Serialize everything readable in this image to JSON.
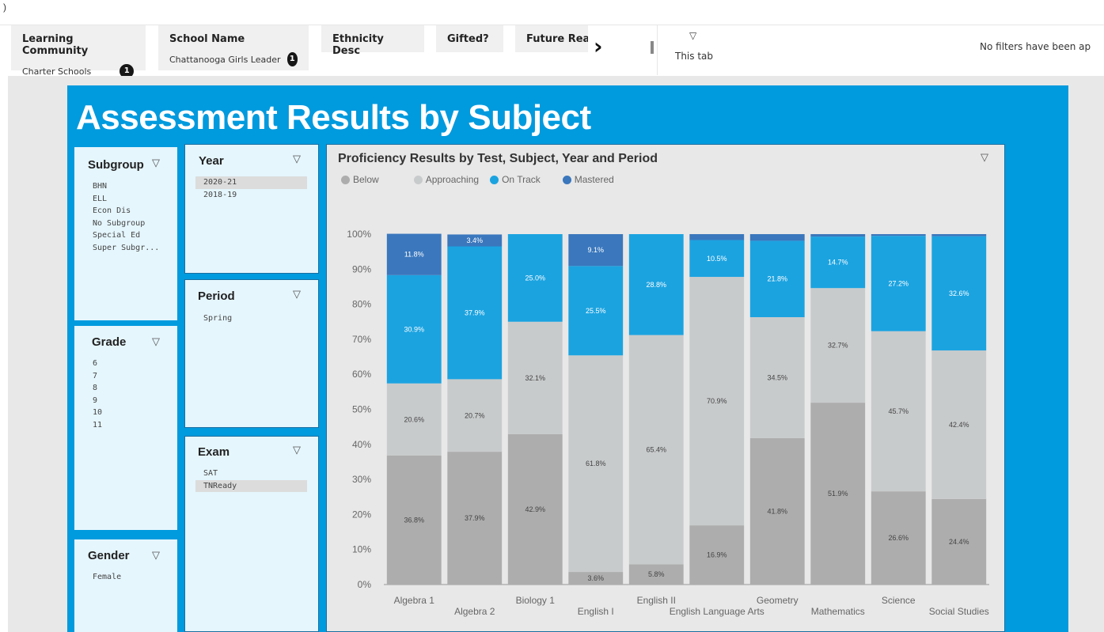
{
  "top_glyph": ")",
  "filters": [
    {
      "name": "Learning Community",
      "value": "Charter Schools",
      "badge": "1"
    },
    {
      "name": "School Name",
      "value": "Chattanooga Girls Leader",
      "badge": "1"
    },
    {
      "name": "Ethnicity Desc"
    },
    {
      "name": "Gifted?"
    },
    {
      "name": "Future Read"
    }
  ],
  "filter_tab": {
    "label": "This tab",
    "message": "No filters have been ap"
  },
  "page_title": "Assessment Results by Subject",
  "slicers": {
    "subgroup": {
      "title": "Subgroup",
      "items": [
        "BHN",
        "ELL",
        "Econ Dis",
        "No Subgroup",
        "Special Ed",
        "Super Subgr..."
      ]
    },
    "grade": {
      "title": "Grade",
      "items": [
        "6",
        "7",
        "8",
        "9",
        "10",
        "11"
      ]
    },
    "gender": {
      "title": "Gender",
      "items": [
        "Female"
      ]
    },
    "year": {
      "title": "Year",
      "items": [
        "2020-21",
        "2018-19"
      ],
      "selected": "2020-21"
    },
    "period": {
      "title": "Period",
      "items": [
        "Spring"
      ]
    },
    "exam": {
      "title": "Exam",
      "items": [
        "SAT",
        "TNReady"
      ],
      "selected": "TNReady"
    }
  },
  "colors": {
    "below": "#adadad",
    "approaching": "#c8cbcc",
    "on_track": "#1ba3e0",
    "mastered": "#3a77bd",
    "board": "#009ade"
  },
  "chart_data": {
    "type": "bar",
    "stacked": true,
    "title": "Proficiency Results by Test, Subject, Year and Period",
    "legend_position": "top-left",
    "categories": [
      "Algebra 1",
      "Algebra 2",
      "Biology 1",
      "English I",
      "English II",
      "English Language Arts",
      "Geometry",
      "Mathematics",
      "Science",
      "Social Studies"
    ],
    "series": [
      {
        "name": "Below",
        "values": [
          36.8,
          37.9,
          42.9,
          3.6,
          5.8,
          16.9,
          41.8,
          51.9,
          26.6,
          24.4
        ],
        "labels": [
          "36.8%",
          "37.9%",
          "42.9%",
          "3.6%",
          "5.8%",
          "16.9%",
          "41.8%",
          "51.9%",
          "26.6%",
          "24.4%"
        ]
      },
      {
        "name": "Approaching",
        "values": [
          20.6,
          20.7,
          32.1,
          61.8,
          65.4,
          70.9,
          34.5,
          32.7,
          45.7,
          42.4
        ],
        "labels": [
          "20.6%",
          "20.7%",
          "32.1%",
          "61.8%",
          "65.4%",
          "70.9%",
          "34.5%",
          "32.7%",
          "45.7%",
          "42.4%"
        ]
      },
      {
        "name": "On Track",
        "values": [
          30.9,
          37.9,
          25.0,
          25.5,
          28.8,
          10.5,
          21.8,
          14.7,
          27.2,
          32.6
        ],
        "labels": [
          "30.9%",
          "37.9%",
          "25.0%",
          "25.5%",
          "28.8%",
          "10.5%",
          "21.8%",
          "14.7%",
          "27.2%",
          "32.6%"
        ]
      },
      {
        "name": "Mastered",
        "values": [
          11.8,
          3.4,
          0,
          9.1,
          0,
          1.7,
          1.9,
          0.7,
          0.5,
          0.6
        ],
        "labels": [
          "11.8%",
          "3.4%",
          "",
          "9.1%",
          "",
          "",
          "",
          "",
          "",
          ""
        ]
      }
    ],
    "y_ticks": [
      "0%",
      "10%",
      "20%",
      "30%",
      "40%",
      "50%",
      "60%",
      "70%",
      "80%",
      "90%",
      "100%"
    ],
    "ylim": [
      0,
      100
    ],
    "grid": false
  }
}
